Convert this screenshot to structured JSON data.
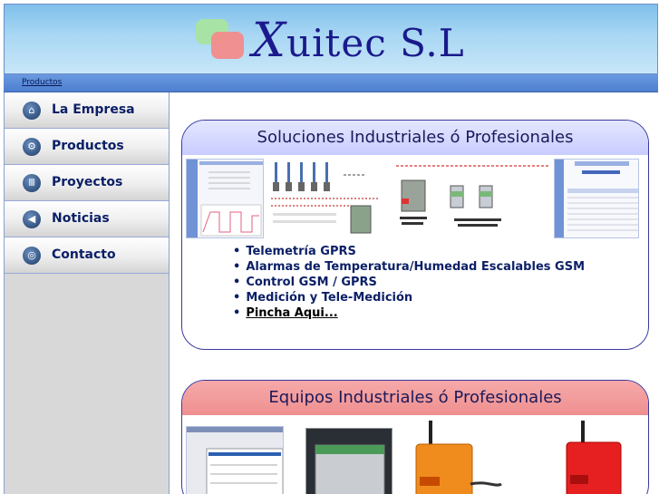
{
  "header": {
    "logo_text": "uitec S.L",
    "logo_initial": "X"
  },
  "breadcrumb": {
    "label": "Productos"
  },
  "sidebar": {
    "items": [
      {
        "label": "La Empresa",
        "icon": "home-icon",
        "glyph": "⌂"
      },
      {
        "label": "Productos",
        "icon": "gear-icon",
        "glyph": "⚙"
      },
      {
        "label": "Proyectos",
        "icon": "columns-icon",
        "glyph": "Ⅲ"
      },
      {
        "label": "Noticias",
        "icon": "megaphone-icon",
        "glyph": "◀"
      },
      {
        "label": "Contacto",
        "icon": "globe-icon",
        "glyph": "◎"
      }
    ]
  },
  "panel1": {
    "title": "Soluciones Industriales ó Profesionales",
    "bullets": [
      "Telemetría GPRS",
      "Alarmas de Temperatura/Humedad Escalables GSM",
      "Control GSM / GPRS",
      "Medición y Tele-Medición"
    ],
    "link_label": "Pincha Aqui..."
  },
  "panel2": {
    "title": "Equipos Industriales ó Profesionales"
  },
  "colors": {
    "header_blue": "#a9d7f4",
    "nav_text": "#0b1f66",
    "panel1_head": "#c8ccff",
    "panel2_head": "#ef8f8f",
    "border": "#3a3aa0"
  }
}
